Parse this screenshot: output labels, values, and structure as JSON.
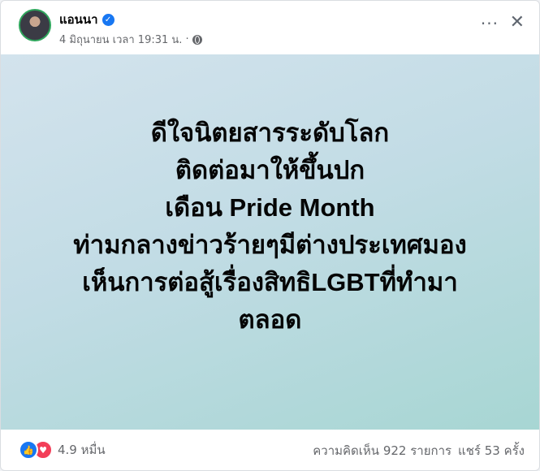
{
  "post": {
    "author": "แอนนา",
    "timestamp": "4 มิถุนายน เวลา 19:31 น.",
    "privacy_icon": "globe-icon",
    "more_label": "···",
    "close_label": "✕",
    "lines": [
      "ดีใจนิตยสารระดับโลก",
      "ติดต่อมาให้ขึ้นปก",
      "เดือน Pride Month",
      "ท่ามกลางข่าวร้ายๆมีต่างประเทศมอง",
      "เห็นการต่อสู้เรื่องสิทธิLGBTที่ทำมา",
      "ตลอด"
    ]
  },
  "footer": {
    "reaction_count": "4.9 หมื่น",
    "comments": "ความคิดเห็น 922 รายการ",
    "shares": "แชร์ 53 ครั้ง"
  },
  "colors": {
    "accent": "#1877f2",
    "love": "#f33e58",
    "online": "#2fa55c"
  }
}
